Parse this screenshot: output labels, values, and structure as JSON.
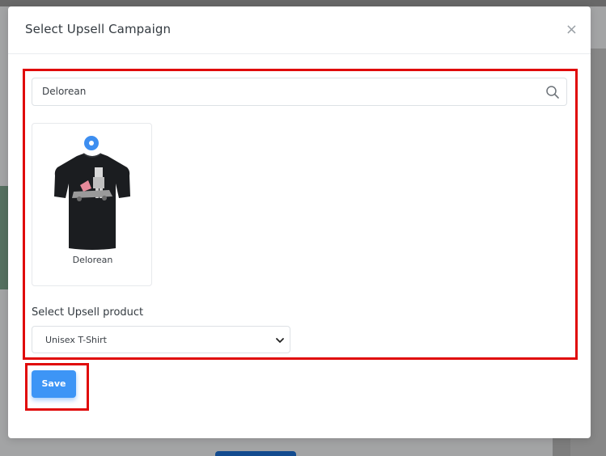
{
  "modal": {
    "title": "Select Upsell Campaign",
    "close_glyph": "×"
  },
  "search": {
    "value": "Delorean",
    "icon": "search-icon"
  },
  "products": [
    {
      "name": "Delorean",
      "selected": true,
      "image": "black-tshirt-delorean-print"
    }
  ],
  "upsell_select": {
    "label": "Select Upsell product",
    "selected": "Unisex T-Shirt"
  },
  "save_label": "Save",
  "colors": {
    "accent": "#3d95f6",
    "highlight": "#e00a0a"
  }
}
